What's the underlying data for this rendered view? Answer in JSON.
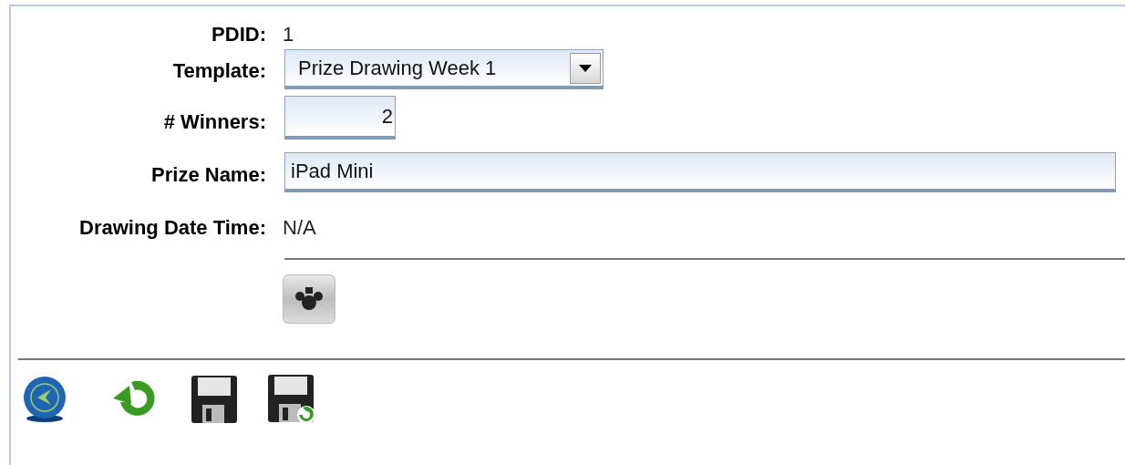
{
  "form": {
    "fields": [
      {
        "kind": "text",
        "label": "PDID:",
        "value": "1"
      },
      {
        "kind": "select",
        "label": "Template:",
        "value": "Prize Drawing Week 1"
      },
      {
        "kind": "number",
        "label": "# Winners:",
        "value": "2"
      },
      {
        "kind": "input",
        "label": "Prize Name:",
        "value": "iPad Mini"
      },
      {
        "kind": "text",
        "label": "Drawing Date Time:",
        "value": "N/A"
      }
    ]
  },
  "toolbar": [
    {
      "kind": "back"
    },
    {
      "kind": "refresh"
    },
    {
      "kind": "save"
    },
    {
      "kind": "save-as"
    }
  ]
}
